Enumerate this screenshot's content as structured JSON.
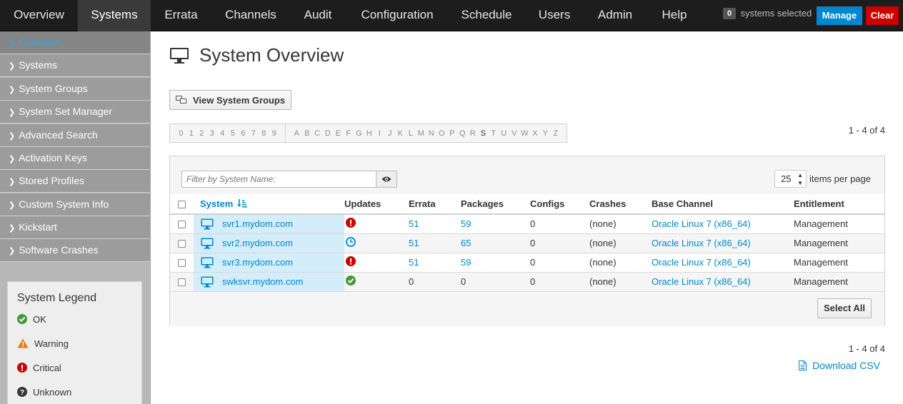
{
  "nav": {
    "items": [
      "Overview",
      "Systems",
      "Errata",
      "Channels",
      "Audit",
      "Configuration",
      "Schedule",
      "Users",
      "Admin",
      "Help"
    ],
    "active": "Systems",
    "selected_count": "0",
    "selected_text": "systems selected",
    "manage_label": "Manage",
    "clear_label": "Clear"
  },
  "sidebar": {
    "items": [
      "Overview",
      "Systems",
      "System Groups",
      "System Set Manager",
      "Advanced Search",
      "Activation Keys",
      "Stored Profiles",
      "Custom System Info",
      "Kickstart",
      "Software Crashes"
    ],
    "active": "Overview"
  },
  "legend": {
    "title": "System Legend",
    "items": [
      {
        "label": "OK",
        "icon": "ok-icon",
        "color": "#3f9c35"
      },
      {
        "label": "Warning",
        "icon": "warning-icon",
        "color": "#ec7a08"
      },
      {
        "label": "Critical",
        "icon": "critical-icon",
        "color": "#cc0000"
      },
      {
        "label": "Unknown",
        "icon": "unknown-icon",
        "color": "#363636"
      }
    ]
  },
  "page": {
    "title": "System Overview",
    "view_groups_label": "View System Groups",
    "digits": [
      "0",
      "1",
      "2",
      "3",
      "4",
      "5",
      "6",
      "7",
      "8",
      "9"
    ],
    "letters": [
      "A",
      "B",
      "C",
      "D",
      "E",
      "F",
      "G",
      "H",
      "I",
      "J",
      "K",
      "L",
      "M",
      "N",
      "O",
      "P",
      "Q",
      "R",
      "S",
      "T",
      "U",
      "V",
      "W",
      "X",
      "Y",
      "Z"
    ],
    "active_letter": "S",
    "pagination_top": "1 - 4 of 4",
    "pagination_bottom": "1 - 4 of 4",
    "download_csv": "Download CSV"
  },
  "table": {
    "filter_placeholder": "Filter by System Name:",
    "items_per_page": "25",
    "items_per_page_label": "items per page",
    "columns": [
      "System",
      "Updates",
      "Errata",
      "Packages",
      "Configs",
      "Crashes",
      "Base Channel",
      "Entitlement"
    ],
    "rows": [
      {
        "system": "svr1.mydom.com",
        "updates": "critical",
        "errata": "51",
        "packages": "59",
        "configs": "0",
        "crashes": "(none)",
        "channel": "Oracle Linux 7 (x86_64)",
        "entitlement": "Management"
      },
      {
        "system": "svr2.mydom.com",
        "updates": "pending",
        "errata": "51",
        "packages": "65",
        "configs": "0",
        "crashes": "(none)",
        "channel": "Oracle Linux 7 (x86_64)",
        "entitlement": "Management"
      },
      {
        "system": "svr3.mydom.com",
        "updates": "critical",
        "errata": "51",
        "packages": "59",
        "configs": "0",
        "crashes": "(none)",
        "channel": "Oracle Linux 7 (x86_64)",
        "entitlement": "Management"
      },
      {
        "system": "swksvr.mydom.com",
        "updates": "ok",
        "errata": "0",
        "packages": "0",
        "configs": "0",
        "crashes": "(none)",
        "channel": "Oracle Linux 7 (x86_64)",
        "entitlement": "Management"
      }
    ],
    "select_all_label": "Select All"
  },
  "colors": {
    "link": "#0088ce",
    "ok": "#3f9c35",
    "critical": "#cc0000",
    "pending": "#0088ce",
    "warning": "#ec7a08"
  }
}
